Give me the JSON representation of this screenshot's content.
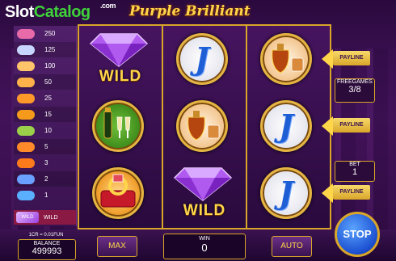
{
  "brand": {
    "logo_part1": "Slot",
    "logo_part2": "Catalog",
    "logo_suffix": ".com"
  },
  "game_title": "Purple Brilliant",
  "paytable": {
    "rows": [
      {
        "value": "250",
        "icon": "flag-icon",
        "color": "#e86aa8"
      },
      {
        "value": "125",
        "icon": "gem-icon",
        "color": "#c8d6ff"
      },
      {
        "value": "100",
        "icon": "coin-icon",
        "color": "#ffc36a"
      },
      {
        "value": "50",
        "icon": "coin-icon",
        "color": "#ffb24a"
      },
      {
        "value": "25",
        "icon": "coin-icon",
        "color": "#ff9a2a"
      },
      {
        "value": "15",
        "icon": "coin-icon",
        "color": "#f59a1a"
      },
      {
        "value": "10",
        "icon": "coin-icon",
        "color": "#9bd14a"
      },
      {
        "value": "5",
        "icon": "coin-icon",
        "color": "#ff8a2a"
      },
      {
        "value": "3",
        "icon": "coin-icon",
        "color": "#ff7a1a"
      },
      {
        "value": "2",
        "icon": "coin-icon",
        "color": "#6aa0ff"
      },
      {
        "value": "1",
        "icon": "coin-icon",
        "color": "#5ab0ff"
      }
    ],
    "wild_label": "WILD",
    "wild_icon_text": "WILD"
  },
  "reels": {
    "wild_text": "WILD",
    "j_text": "J"
  },
  "paylines": {
    "label1": "PAYLINE",
    "label2": "PAYLINE",
    "label3": "PAYLINE"
  },
  "freegames": {
    "title": "FREEGAMES",
    "value": "3/8"
  },
  "bet": {
    "title": "BET",
    "value": "1"
  },
  "bottom": {
    "denomination": "1CR = 0.01FUN",
    "balance_label": "BALANCE",
    "balance_value": "499993",
    "max_label": "MAX",
    "win_label": "WIN",
    "win_value": "0",
    "auto_label": "AUTO",
    "stop_label": "STOP"
  },
  "colors": {
    "accent": "#d9a62a",
    "gold_text": "#ffd54a",
    "reel_bg": "#4a1466",
    "stop_button": "#1b4fd0"
  }
}
